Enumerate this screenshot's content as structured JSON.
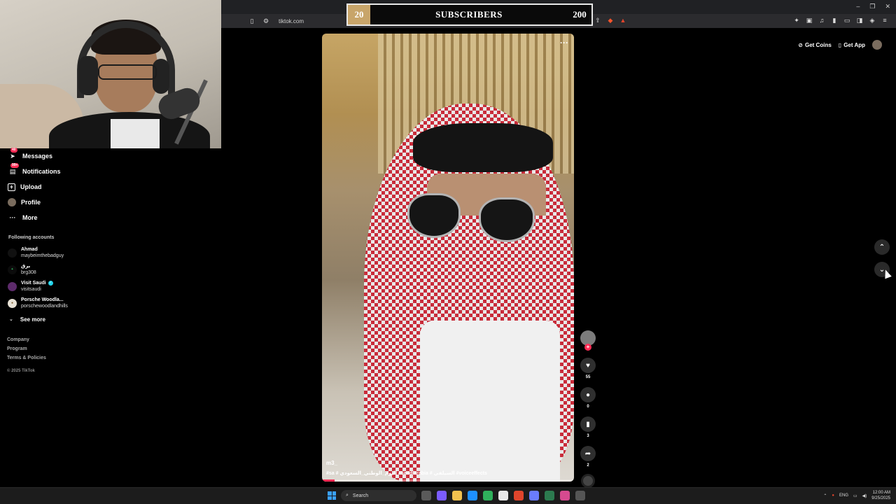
{
  "browser": {
    "url": "tiktok.com",
    "window_controls": [
      "–",
      "❐",
      "✕"
    ]
  },
  "overlay": {
    "start": "20",
    "title": "SUBSCRIBERS",
    "end": "200"
  },
  "header": {
    "get_coins": "Get Coins",
    "get_app": "Get App"
  },
  "sidebar": {
    "items": [
      {
        "label": "Messages",
        "badge": "40"
      },
      {
        "label": "Notifications",
        "badge": "99+"
      },
      {
        "label": "Upload",
        "badge": ""
      },
      {
        "label": "Profile",
        "badge": ""
      },
      {
        "label": "More",
        "badge": ""
      }
    ],
    "following_title": "Following accounts",
    "accounts": [
      {
        "name": "Ahmad",
        "handle": "maybeimthebadguy",
        "verified": false
      },
      {
        "name": "برق",
        "handle": "brg308",
        "verified": false
      },
      {
        "name": "Visit Saudi",
        "handle": "visitsaudi",
        "verified": true
      },
      {
        "name": "Porsche Woodla...",
        "handle": "porschewoodlandhills",
        "verified": false
      }
    ],
    "see_more": "See more",
    "footer": [
      "Company",
      "Program",
      "Terms & Policies"
    ],
    "copyright": "© 2025 TikTok"
  },
  "video": {
    "user": "m3_",
    "tags": "#sa  # اليوم_الوطني_السعودي  #saudiarabia  # السيلفي  #voiceeffects",
    "progress": 0.05,
    "likes": "55",
    "comments": "0",
    "saves": "3",
    "shares": "2"
  },
  "taskbar": {
    "search": "Search",
    "lang": "ENG",
    "time": "12:00 AM",
    "date": "9/25/2025",
    "app_colors": [
      "#5a5a5a",
      "#7b5cff",
      "#f2c14e",
      "#1e90ff",
      "#2fb15c",
      "#e8e8e8",
      "#e0452c",
      "#6a7cff",
      "#2c7a4f",
      "#d64a8f",
      "#555555"
    ]
  },
  "colors": {
    "accent": "#fe2c55"
  }
}
